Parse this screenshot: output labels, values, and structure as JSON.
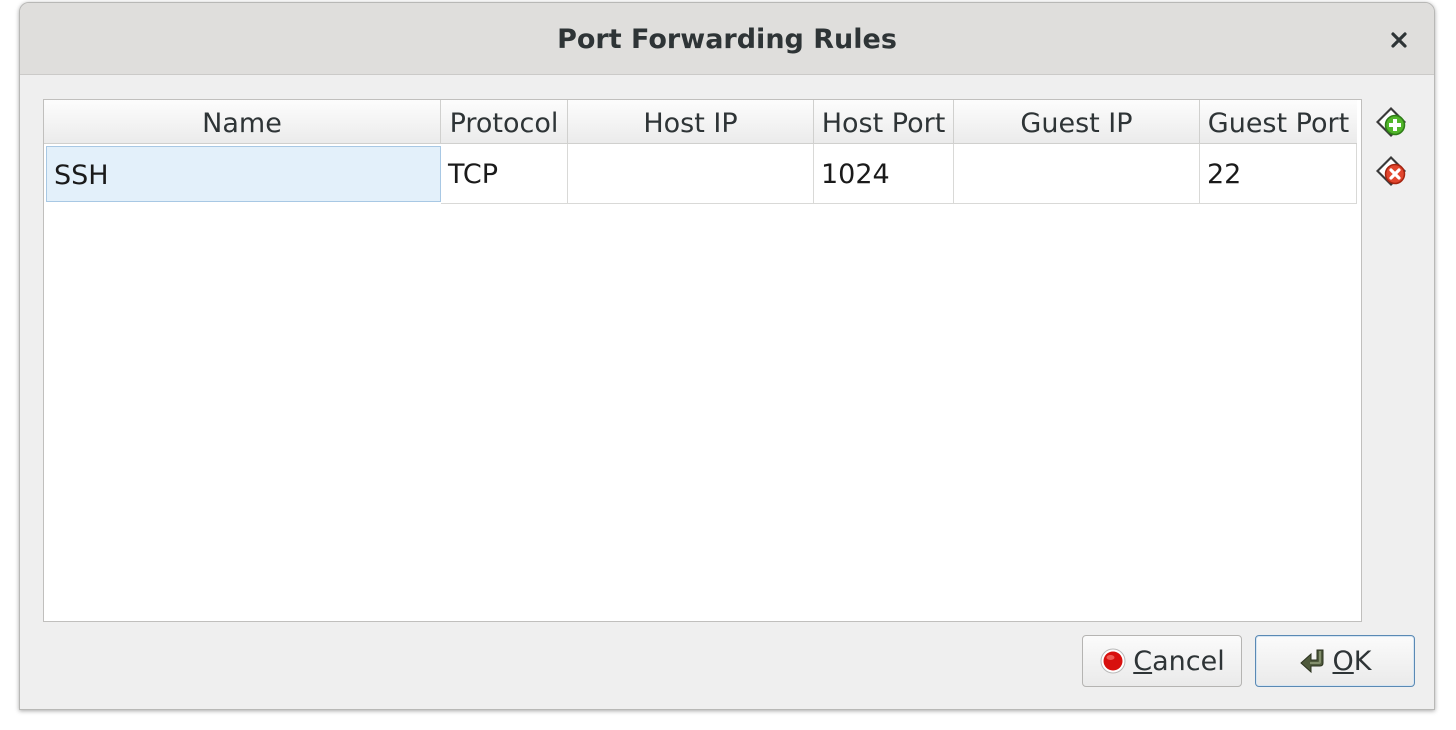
{
  "dialog": {
    "title": "Port Forwarding Rules"
  },
  "table": {
    "columns": [
      "Name",
      "Protocol",
      "Host IP",
      "Host Port",
      "Guest IP",
      "Guest Port"
    ],
    "rows": [
      [
        "SSH",
        "TCP",
        "",
        "1024",
        "",
        "22"
      ]
    ]
  },
  "buttons": {
    "cancel": {
      "mnemonic": "C",
      "rest": "ancel"
    },
    "ok": {
      "mnemonic": "O",
      "rest": "K"
    }
  },
  "icons": {
    "add": "add-rule-icon",
    "remove": "remove-rule-icon",
    "close": "close-icon",
    "cancel": "stop-icon",
    "ok": "enter-arrow-icon"
  },
  "colors": {
    "add_icon_green": "#52b62b",
    "remove_icon_red": "#e2462e",
    "cancel_icon_red": "#d8100e",
    "selected_cell": "#e3f0fa"
  }
}
